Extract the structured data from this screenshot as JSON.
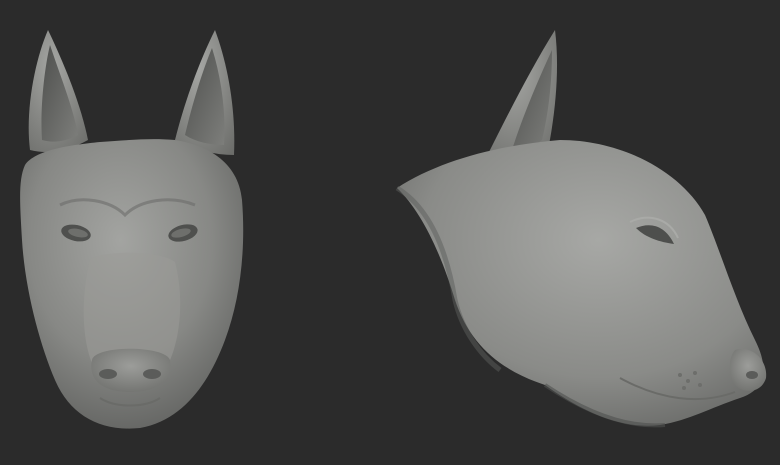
{
  "scene": {
    "background_color": "#2b2b2b",
    "material_color": "#8a8b88",
    "views": [
      {
        "id": "front",
        "subject": "dog-head-sculpt",
        "orientation": "front"
      },
      {
        "id": "side",
        "subject": "dog-head-sculpt",
        "orientation": "three-quarter-right"
      }
    ]
  }
}
